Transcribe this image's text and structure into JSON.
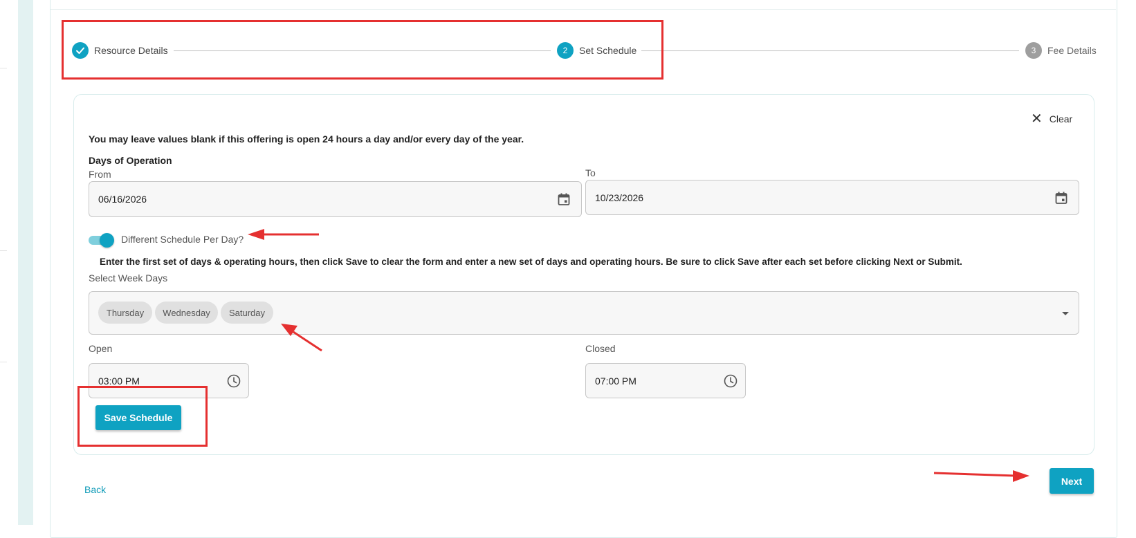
{
  "stepper": {
    "steps": [
      {
        "number": "",
        "label": "Resource Details",
        "state": "complete"
      },
      {
        "number": "2",
        "label": "Set Schedule",
        "state": "active"
      },
      {
        "number": "3",
        "label": "Fee Details",
        "state": "pending"
      }
    ]
  },
  "schedule": {
    "clear_label": "Clear",
    "intro": "You may leave values blank if this offering is open 24 hours a day and/or every day of the year.",
    "days_heading": "Days of Operation",
    "from_label": "From",
    "from_value": "06/16/2026",
    "to_label": "To",
    "to_value": "10/23/2026",
    "toggle_label": "Different Schedule Per Day?",
    "toggle_on": true,
    "instructions": "Enter the first set of days & operating hours, then click Save to clear the form and enter a new set of days and operating hours. Be sure to click Save after each set before clicking Next or Submit.",
    "weekdays_label": "Select Week Days",
    "selected_days": [
      "Thursday",
      "Wednesday",
      "Saturday"
    ],
    "open_label": "Open",
    "open_value": "03:00 PM",
    "closed_label": "Closed",
    "closed_value": "07:00 PM",
    "save_label": "Save Schedule"
  },
  "nav": {
    "back_label": "Back",
    "next_label": "Next"
  },
  "colors": {
    "accent": "#0fa2c2",
    "annotation": "#e53030"
  }
}
